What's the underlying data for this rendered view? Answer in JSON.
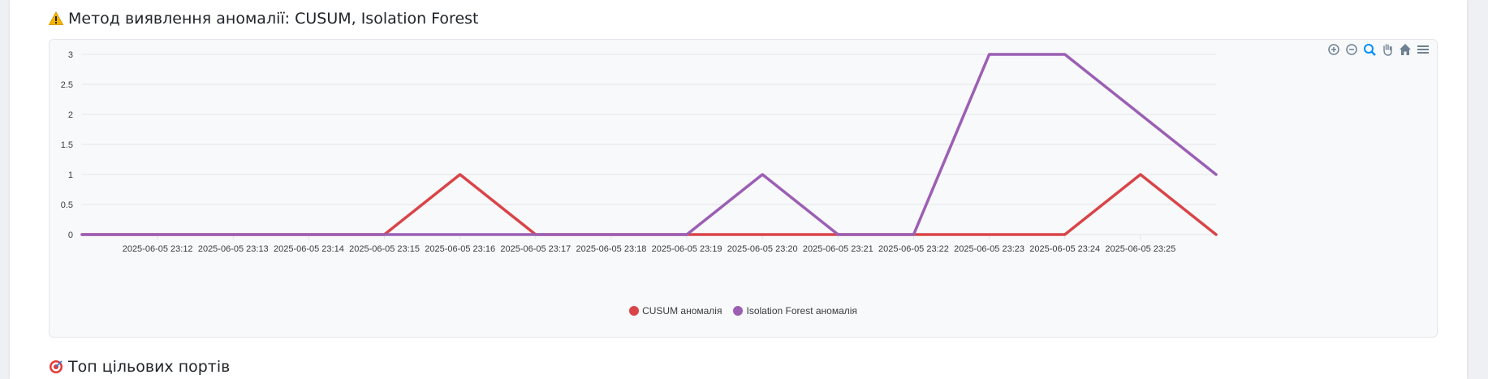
{
  "headings": {
    "anomaly_method": "Метод виявлення аномалії: CUSUM, Isolation Forest",
    "anomaly_icon": "warning-icon",
    "top_ports": "Топ цільових портів",
    "ports_icon": "target-icon"
  },
  "toolbar": [
    "zoom-in-icon",
    "zoom-out-icon",
    "zoom-selection-icon",
    "pan-icon",
    "reset-home-icon",
    "menu-icon"
  ],
  "chart_data": {
    "type": "line",
    "x_labels": [
      "2025-06-05 23:12",
      "2025-06-05 23:13",
      "2025-06-05 23:14",
      "2025-06-05 23:15",
      "2025-06-05 23:16",
      "2025-06-05 23:17",
      "2025-06-05 23:18",
      "2025-06-05 23:19",
      "2025-06-05 23:20",
      "2025-06-05 23:21",
      "2025-06-05 23:22",
      "2025-06-05 23:23",
      "2025-06-05 23:24",
      "2025-06-05 23:25"
    ],
    "x_points": [
      "23:11",
      "23:12",
      "23:13",
      "23:14",
      "23:15",
      "23:16",
      "23:17",
      "23:18",
      "23:19",
      "23:20",
      "23:21",
      "23:22",
      "23:23",
      "23:24",
      "23:25",
      "23:26"
    ],
    "series": [
      {
        "name": "CUSUM аномалія",
        "color": "#d94448",
        "values": [
          0,
          0,
          0,
          0,
          0,
          1,
          0,
          0,
          0,
          0,
          0,
          0,
          0,
          0,
          1,
          0
        ]
      },
      {
        "name": "Isolation Forest аномалія",
        "color": "#9b5fb4",
        "values": [
          0,
          0,
          0,
          0,
          0,
          0,
          0,
          0,
          0,
          1,
          0,
          0,
          3,
          3,
          2,
          1
        ]
      }
    ],
    "yticks": [
      "0",
      "0.5",
      "1",
      "1.5",
      "2",
      "2.5",
      "3"
    ],
    "ylim": [
      0,
      3
    ],
    "grid": true,
    "legend_position": "bottom"
  }
}
